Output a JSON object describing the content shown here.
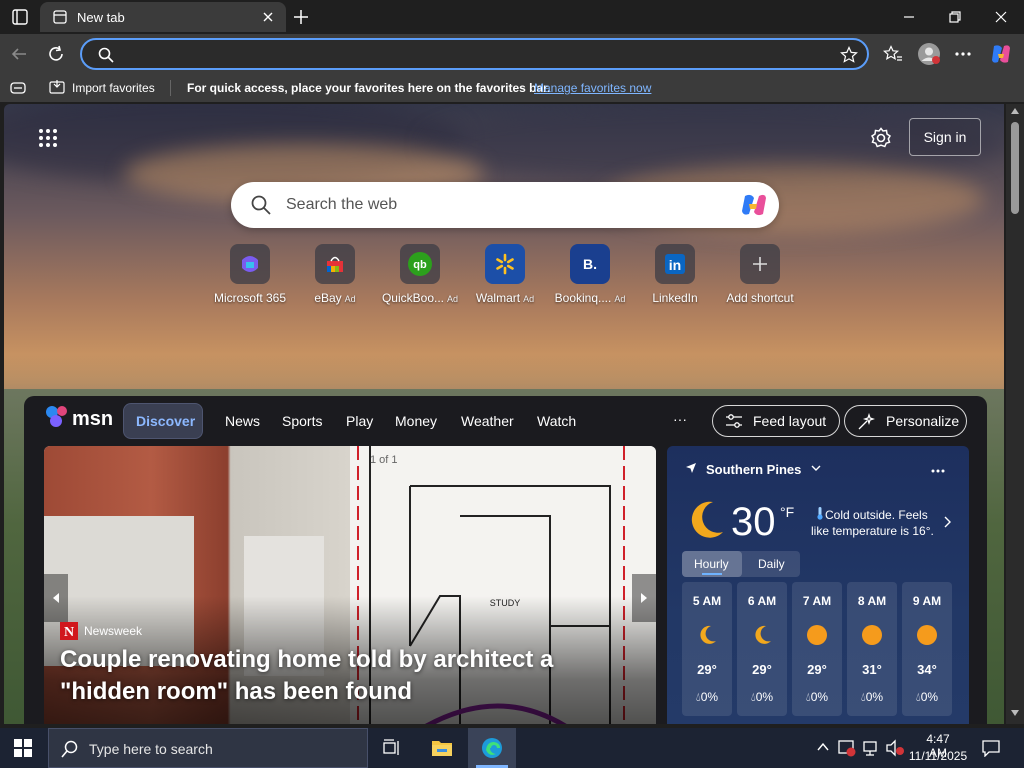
{
  "browser": {
    "tab_title": "New tab",
    "omnibox_value": "",
    "favbar": {
      "import_label": "Import favorites",
      "message": "For quick access, place your favorites here on the favorites bar.",
      "manage_link": "Manage favorites now"
    }
  },
  "newtab": {
    "sign_in": "Sign in",
    "search_placeholder": "Search the web",
    "shortcuts": [
      {
        "name": "Microsoft 365",
        "ad": "",
        "icon": "microsoft-365-icon"
      },
      {
        "name": "eBay",
        "ad": "Ad",
        "icon": "ebay-icon"
      },
      {
        "name": "QuickBoo...",
        "ad": "Ad",
        "icon": "quickbooks-icon"
      },
      {
        "name": "Walmart",
        "ad": "Ad",
        "icon": "walmart-icon"
      },
      {
        "name": "Bookinq....",
        "ad": "Ad",
        "icon": "booking-icon"
      },
      {
        "name": "LinkedIn",
        "ad": "",
        "icon": "linkedin-icon"
      },
      {
        "name": "Add shortcut",
        "ad": "",
        "icon": "plus-icon"
      }
    ]
  },
  "msn": {
    "brand": "msn",
    "nav": [
      "Discover",
      "News",
      "Sports",
      "Play",
      "Money",
      "Weather",
      "Watch"
    ],
    "more": "···",
    "feed_layout": "Feed layout",
    "personalize": "Personalize",
    "hero": {
      "counter": "1 of 1",
      "source": "Newsweek",
      "title": "Couple renovating home told by architect a \"hidden room\" has been found"
    },
    "weather": {
      "location": "Southern Pines",
      "temp": "30",
      "unit": "°F",
      "summary": "Cold outside. Feels like temperature is 16°.",
      "tabs": [
        "Hourly",
        "Daily"
      ],
      "hours": [
        {
          "time": "5 AM",
          "icon": "moon-icon",
          "temp": "29°",
          "precip": "0%"
        },
        {
          "time": "6 AM",
          "icon": "moon-icon",
          "temp": "29°",
          "precip": "0%"
        },
        {
          "time": "7 AM",
          "icon": "sun-icon",
          "temp": "29°",
          "precip": "0%"
        },
        {
          "time": "8 AM",
          "icon": "sun-icon",
          "temp": "31°",
          "precip": "0%"
        },
        {
          "time": "9 AM",
          "icon": "sun-icon",
          "temp": "34°",
          "precip": "0%"
        }
      ]
    }
  },
  "taskbar": {
    "search_placeholder": "Type here to search",
    "time": "4:47 AM",
    "date": "11/11/2025"
  },
  "colors": {
    "accent": "#5b9df9",
    "link": "#7fb6ff",
    "taskbar": "#1c2333",
    "weather_panel": "#223866"
  }
}
